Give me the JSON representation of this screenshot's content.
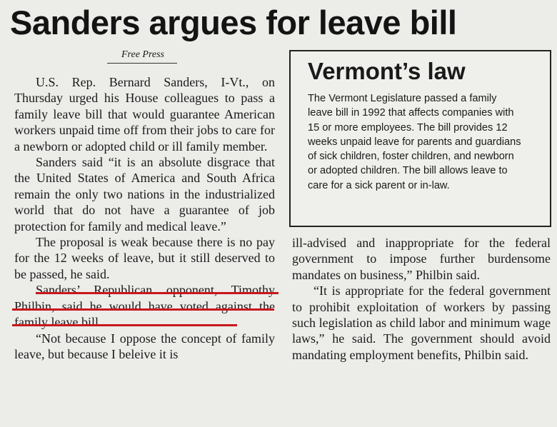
{
  "headline": "Sanders argues for leave bill",
  "byline": "Free Press",
  "left_column": [
    "U.S. Rep. Bernard Sanders, I-Vt., on Thursday urged his House colleagues to pass a family leave bill that would guarantee American workers unpaid time off from their jobs to care for a newborn or adopted child or ill family member.",
    "Sanders said “it is an absolute disgrace that the United States of America and South Africa remain the only two nations in the industrialized world that do not have a guarantee of job protection for family and medical leave.”",
    "The proposal is weak because there is no pay for the 12 weeks of leave, but it still deserved to be passed, he said.",
    "Sanders’ Republican opponent, Timothy Philbin, said he would have voted against the family leave bill.",
    "“Not because I oppose the concept of family leave, but because I beleive it is"
  ],
  "sidebar": {
    "title": "Vermont’s law",
    "body": "The Vermont Legislature passed a family leave bill in 1992 that affects companies with 15 or more employees. The bill provides 12 weeks unpaid leave for parents and guardians of sick children, foster children, and newborn or adopted children. The bill allows leave to care for a sick parent or in-law."
  },
  "right_column": [
    "ill-advised and inappropriate for the federal government to impose further burdensome mandates on business,” Philbin said.",
    "“It is appropriate for the federal government to prohibit exploitation of workers by passing such legislation as child labor and minimum wage laws,” he said. The government should avoid mandating employment benefits, Philbin said."
  ],
  "colors": {
    "paper": "#ecece9",
    "ink": "#1a1a1a",
    "underline": "#c8171c"
  }
}
